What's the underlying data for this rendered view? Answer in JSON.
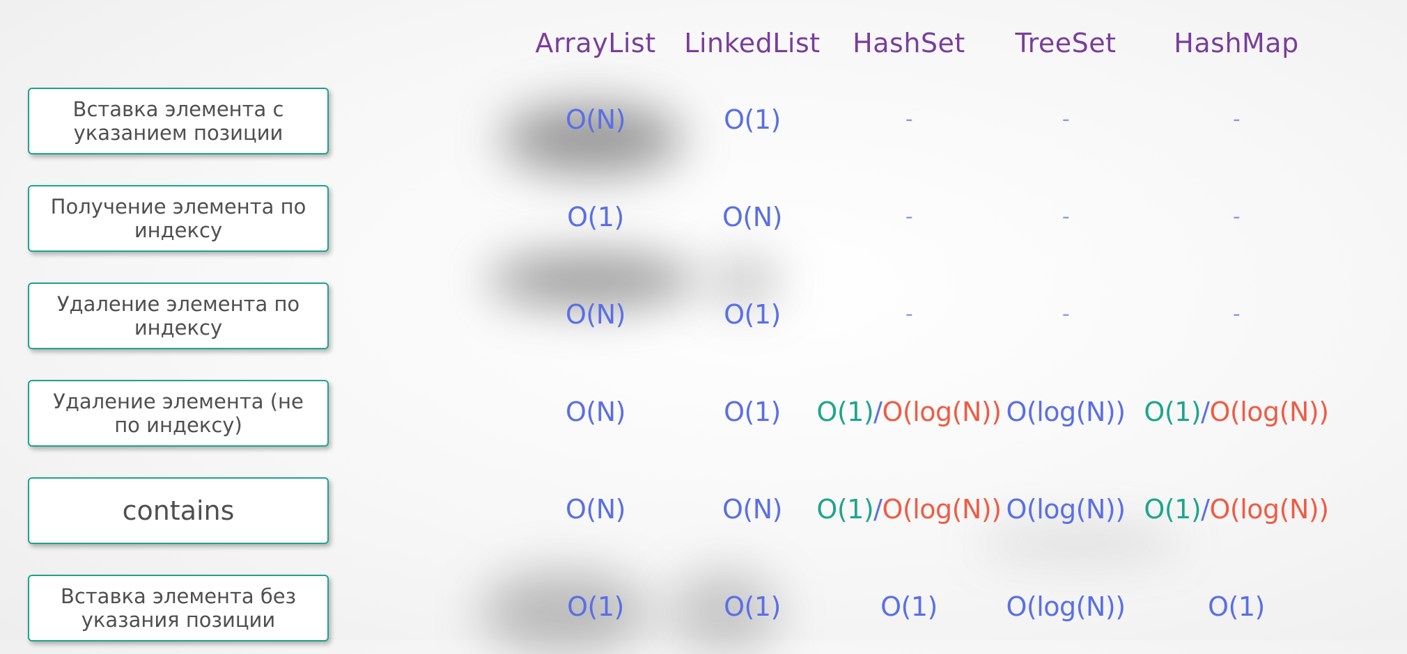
{
  "columns": [
    "ArrayList",
    "LinkedList",
    "HashSet",
    "TreeSet",
    "HashMap"
  ],
  "rows": [
    {
      "label": "Вставка элемента с указанием позиции",
      "cells": [
        {
          "text": "O(N)"
        },
        {
          "text": "O(1)"
        },
        {
          "text": "-"
        },
        {
          "text": "-"
        },
        {
          "text": "-"
        }
      ]
    },
    {
      "label": "Получение элемента по индексу",
      "cells": [
        {
          "text": "O(1)"
        },
        {
          "text": "O(N)"
        },
        {
          "text": "-"
        },
        {
          "text": "-"
        },
        {
          "text": "-"
        }
      ]
    },
    {
      "label": "Удаление элемента по индексу",
      "cells": [
        {
          "text": "O(N)"
        },
        {
          "text": "O(1)"
        },
        {
          "text": "-"
        },
        {
          "text": "-"
        },
        {
          "text": "-"
        }
      ]
    },
    {
      "label": "Удаление элемента (не по индексу)",
      "cells": [
        {
          "text": "O(N)"
        },
        {
          "text": "O(1)"
        },
        {
          "avg": "O(1)",
          "sep": "/",
          "worst": "O(log(N))"
        },
        {
          "text": "O(log(N))"
        },
        {
          "avg": "O(1)",
          "sep": "/",
          "worst": "O(log(N))"
        }
      ]
    },
    {
      "label": "contains",
      "cells": [
        {
          "text": "O(N)"
        },
        {
          "text": "O(N)"
        },
        {
          "avg": "O(1)",
          "sep": "/",
          "worst": "O(log(N))"
        },
        {
          "text": "O(log(N))"
        },
        {
          "avg": "O(1)",
          "sep": "/",
          "worst": "O(log(N))"
        }
      ]
    },
    {
      "label": "Вставка элемента без указания позиции",
      "cells": [
        {
          "text": "O(1)"
        },
        {
          "text": "O(1)"
        },
        {
          "text": "O(1)"
        },
        {
          "text": "O(log(N))"
        },
        {
          "text": "O(1)"
        }
      ]
    }
  ],
  "colors": {
    "header": "#7a3d9b",
    "value": "#5a6fe6",
    "average_case": "#1ea58c",
    "worst_case": "#ee5c45",
    "label_border": "#1ea38a"
  }
}
